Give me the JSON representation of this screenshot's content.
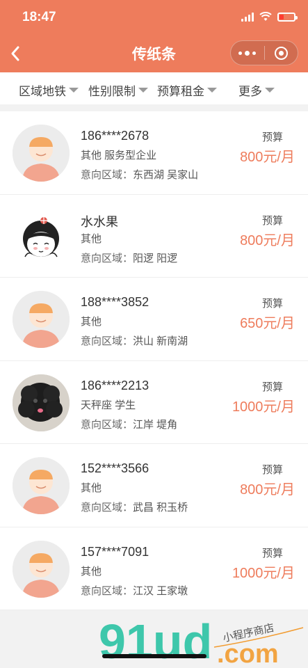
{
  "status": {
    "time": "18:47"
  },
  "nav": {
    "title": "传纸条"
  },
  "filters": [
    {
      "label": "区域地铁"
    },
    {
      "label": "性别限制"
    },
    {
      "label": "预算租金"
    },
    {
      "label": "更多"
    }
  ],
  "list": {
    "budget_label": "预算",
    "area_label": "意向区域：",
    "items": [
      {
        "name": "186****2678",
        "tags": "其他 服务型企业",
        "area": "东西湖 吴家山",
        "price": "800元/月",
        "avatar": "default-avatar-icon"
      },
      {
        "name": "水水果",
        "tags": "其他",
        "area": "阳逻 阳逻",
        "price": "800元/月",
        "avatar": "cartoon-girl-avatar"
      },
      {
        "name": "188****3852",
        "tags": "其他",
        "area": "洪山 新南湖",
        "price": "650元/月",
        "avatar": "default-avatar-icon"
      },
      {
        "name": "186****2213",
        "tags": "天秤座 学生",
        "area": "江岸 堤角",
        "price": "1000元/月",
        "avatar": "black-poodle-photo"
      },
      {
        "name": "152****3566",
        "tags": "其他",
        "area": "武昌 积玉桥",
        "price": "800元/月",
        "avatar": "default-avatar-icon"
      },
      {
        "name": "157****7091",
        "tags": "其他",
        "area": "江汉 王家墩",
        "price": "1000元/月",
        "avatar": "default-avatar-icon"
      }
    ]
  },
  "watermark": {
    "brand": "91ud",
    "domain": ".com",
    "tagline": "小程序商店"
  },
  "colors": {
    "accent": "#ee7c5c",
    "watermark_teal": "#1fbf9f",
    "watermark_orange": "#f29b2f"
  }
}
